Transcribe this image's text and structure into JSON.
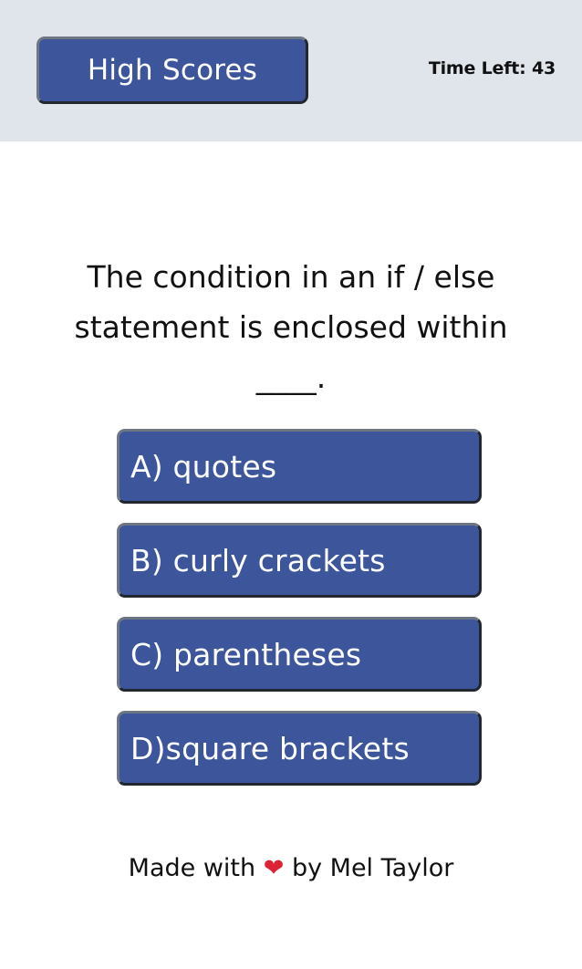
{
  "header": {
    "high_scores_label": "High Scores",
    "time_left_label": "Time Left: 43"
  },
  "quiz": {
    "question": "The condition in an if / else statement is enclosed within ____.",
    "answers": [
      {
        "label": "A) quotes"
      },
      {
        "label": "B) curly crackets"
      },
      {
        "label": "C) parentheses"
      },
      {
        "label": "D)square brackets"
      }
    ]
  },
  "footer": {
    "made_with": "Made with",
    "heart_icon": "❤",
    "by_author": "by Mel Taylor"
  },
  "colors": {
    "header_bg": "#e0e5eb",
    "button_bg": "#3d569b",
    "heart": "#dd2233"
  }
}
